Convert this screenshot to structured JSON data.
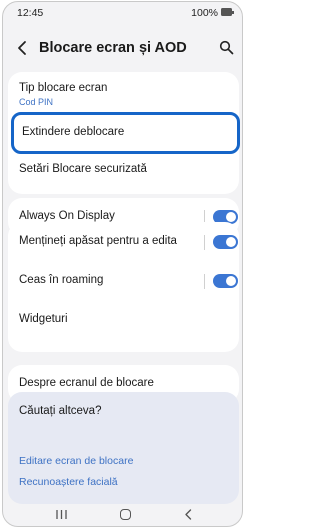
{
  "status_bar": {
    "time": "12:45",
    "battery": "100%"
  },
  "app_bar": {
    "title": "Blocare ecran și AOD",
    "back_icon": "back-arrow-icon",
    "search_icon": "search-icon"
  },
  "security_card": {
    "lock_type": {
      "label": "Tip blocare ecran",
      "value": "Cod PIN"
    },
    "extend_unlock": {
      "label": "Extindere deblocare"
    },
    "secure_lock_settings": {
      "label": "Setări Blocare securizată"
    }
  },
  "aod_card": {
    "always_on_display": {
      "label": "Always On Display",
      "enabled": true
    }
  },
  "lockscreen_card": {
    "hold_to_edit": {
      "label": "Mențineți apăsat pentru a edita",
      "enabled": true
    },
    "roaming_clock": {
      "label": "Ceas în roaming",
      "enabled": true
    },
    "widgets": {
      "label": "Widgeturi"
    }
  },
  "about_card": {
    "about_lock_screen": {
      "label": "Despre ecranul de blocare"
    }
  },
  "suggestions": {
    "title": "Căutați altceva?",
    "links": [
      "Editare ecran de blocare",
      "Recunoaștere facială"
    ]
  },
  "colors": {
    "accent": "#3b76d3",
    "highlight": "#1565c8",
    "link": "#3e72c4"
  },
  "nav_bar": {
    "recents_icon": "recents-icon",
    "home_icon": "home-icon",
    "back_icon": "back-icon"
  }
}
